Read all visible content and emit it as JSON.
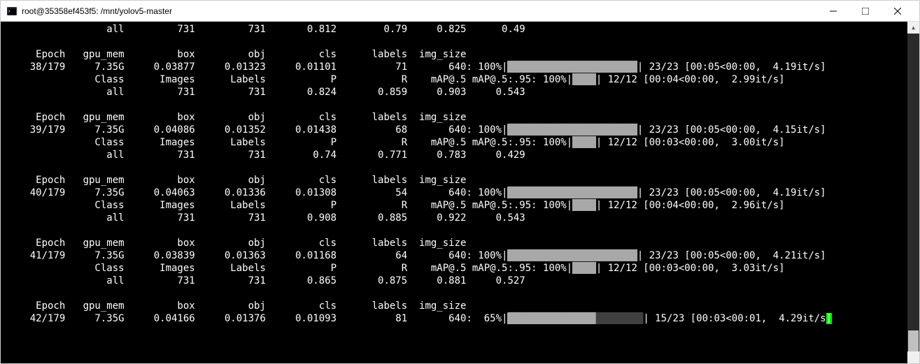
{
  "window": {
    "title": "root@35358ef453f5: /mnt/yolov5-master"
  },
  "top_line": {
    "label": "all",
    "images": "731",
    "labels": "731",
    "p": "0.812",
    "r": "0.79",
    "map50": "0.825",
    "map95": "0.49"
  },
  "blocks": [
    {
      "headers": {
        "c1": "Epoch",
        "c2": "gpu_mem",
        "c3": "box",
        "c4": "obj",
        "c5": "cls",
        "c6": "labels",
        "c7": "img_size"
      },
      "train": {
        "epoch": "38/179",
        "gpu": "7.35G",
        "box": "0.03877",
        "obj": "0.01323",
        "cls": "0.01101",
        "labels": "71",
        "img": "640",
        "pct": "100%",
        "iter": "23/23",
        "time": "[00:05<00:00,",
        "rate": "4.19it/s]"
      },
      "val_headers": {
        "c1": "Class",
        "c2": "Images",
        "c3": "Labels",
        "c4": "P",
        "c5": "R",
        "c6": "mAP@.5",
        "c7": "mAP@.5:.95",
        "pct": "100%",
        "iter": "12/12",
        "time": "[00:04<00:00,",
        "rate": "2.99it/s]"
      },
      "val": {
        "label": "all",
        "images": "731",
        "labels": "731",
        "p": "0.824",
        "r": "0.859",
        "map50": "0.903",
        "map95": "0.543"
      }
    },
    {
      "headers": {
        "c1": "Epoch",
        "c2": "gpu_mem",
        "c3": "box",
        "c4": "obj",
        "c5": "cls",
        "c6": "labels",
        "c7": "img_size"
      },
      "train": {
        "epoch": "39/179",
        "gpu": "7.35G",
        "box": "0.04086",
        "obj": "0.01352",
        "cls": "0.01438",
        "labels": "68",
        "img": "640",
        "pct": "100%",
        "iter": "23/23",
        "time": "[00:05<00:00,",
        "rate": "4.15it/s]"
      },
      "val_headers": {
        "c1": "Class",
        "c2": "Images",
        "c3": "Labels",
        "c4": "P",
        "c5": "R",
        "c6": "mAP@.5",
        "c7": "mAP@.5:.95",
        "pct": "100%",
        "iter": "12/12",
        "time": "[00:03<00:00,",
        "rate": "3.00it/s]"
      },
      "val": {
        "label": "all",
        "images": "731",
        "labels": "731",
        "p": "0.74",
        "r": "0.771",
        "map50": "0.783",
        "map95": "0.429"
      }
    },
    {
      "headers": {
        "c1": "Epoch",
        "c2": "gpu_mem",
        "c3": "box",
        "c4": "obj",
        "c5": "cls",
        "c6": "labels",
        "c7": "img_size"
      },
      "train": {
        "epoch": "40/179",
        "gpu": "7.35G",
        "box": "0.04063",
        "obj": "0.01336",
        "cls": "0.01308",
        "labels": "54",
        "img": "640",
        "pct": "100%",
        "iter": "23/23",
        "time": "[00:05<00:00,",
        "rate": "4.19it/s]"
      },
      "val_headers": {
        "c1": "Class",
        "c2": "Images",
        "c3": "Labels",
        "c4": "P",
        "c5": "R",
        "c6": "mAP@.5",
        "c7": "mAP@.5:.95",
        "pct": "100%",
        "iter": "12/12",
        "time": "[00:04<00:00,",
        "rate": "2.96it/s]"
      },
      "val": {
        "label": "all",
        "images": "731",
        "labels": "731",
        "p": "0.908",
        "r": "0.885",
        "map50": "0.922",
        "map95": "0.543"
      }
    },
    {
      "headers": {
        "c1": "Epoch",
        "c2": "gpu_mem",
        "c3": "box",
        "c4": "obj",
        "c5": "cls",
        "c6": "labels",
        "c7": "img_size"
      },
      "train": {
        "epoch": "41/179",
        "gpu": "7.35G",
        "box": "0.03839",
        "obj": "0.01363",
        "cls": "0.01168",
        "labels": "64",
        "img": "640",
        "pct": "100%",
        "iter": "23/23",
        "time": "[00:05<00:00,",
        "rate": "4.21it/s]"
      },
      "val_headers": {
        "c1": "Class",
        "c2": "Images",
        "c3": "Labels",
        "c4": "P",
        "c5": "R",
        "c6": "mAP@.5",
        "c7": "mAP@.5:.95",
        "pct": "100%",
        "iter": "12/12",
        "time": "[00:03<00:00,",
        "rate": "3.03it/s]"
      },
      "val": {
        "label": "all",
        "images": "731",
        "labels": "731",
        "p": "0.865",
        "r": "0.875",
        "map50": "0.881",
        "map95": "0.527"
      }
    }
  ],
  "last": {
    "headers": {
      "c1": "Epoch",
      "c2": "gpu_mem",
      "c3": "box",
      "c4": "obj",
      "c5": "cls",
      "c6": "labels",
      "c7": "img_size"
    },
    "train": {
      "epoch": "42/179",
      "gpu": "7.35G",
      "box": "0.04166",
      "obj": "0.01376",
      "cls": "0.01093",
      "labels": "81",
      "img": "640",
      "pct": "65%",
      "iter": "15/23",
      "time": "[00:03<00:01,",
      "rate": "4.29it/s"
    }
  }
}
